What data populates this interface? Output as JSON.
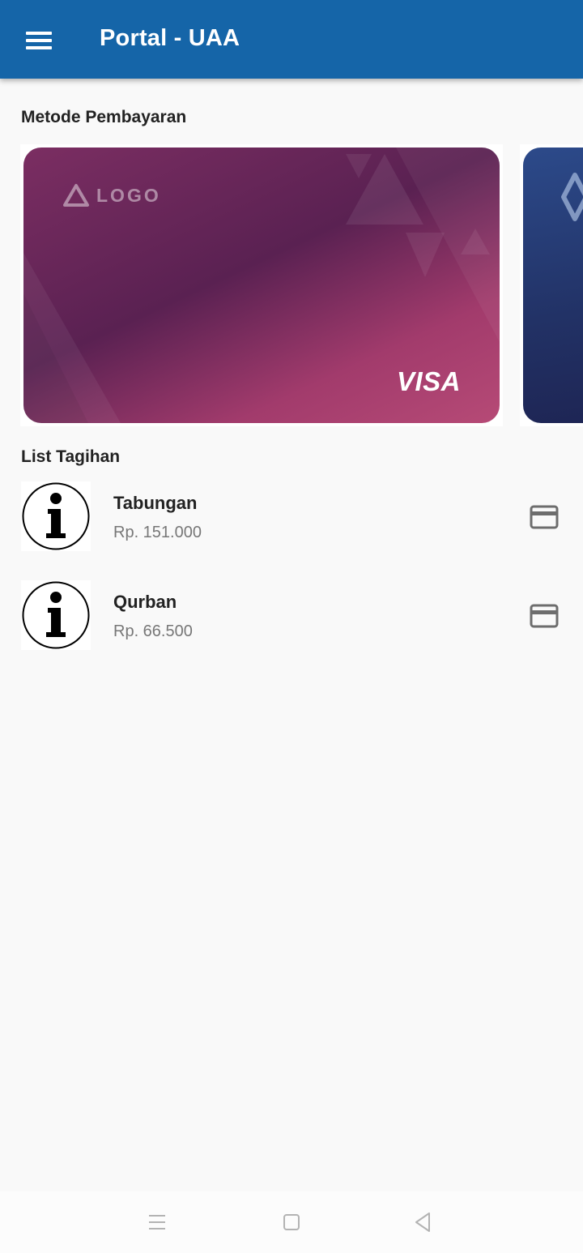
{
  "appbar": {
    "title": "Portal - UAA",
    "menu_icon": "hamburger-menu-icon",
    "background": "#1565a8"
  },
  "payment_methods": {
    "heading": "Metode Pembayaran",
    "cards": [
      {
        "logo_text": "LOGO",
        "brand": "VISA",
        "colors": [
          "#5a2152",
          "#b64a76"
        ]
      },
      {
        "logo_icon": "diamond-logo-icon",
        "colors": [
          "#2c4a8a",
          "#1e2554"
        ]
      }
    ]
  },
  "bills": {
    "heading": "List Tagihan",
    "items": [
      {
        "name": "Tabungan",
        "amount": "Rp. 151.000",
        "icon": "info-icon",
        "action_icon": "credit-card-icon"
      },
      {
        "name": "Qurban",
        "amount": "Rp. 66.500",
        "icon": "info-icon",
        "action_icon": "credit-card-icon"
      }
    ]
  },
  "system_nav": {
    "recent_icon": "recent-apps-icon",
    "home_icon": "home-icon",
    "back_icon": "back-icon"
  }
}
